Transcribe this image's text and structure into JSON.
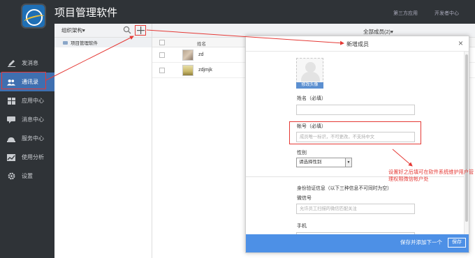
{
  "header": {
    "app_title": "项目管理软件",
    "links": [
      "第三方应用",
      "开发者中心"
    ]
  },
  "sidebar": {
    "items": [
      {
        "label": "发消息",
        "icon": "pencil-icon"
      },
      {
        "label": "通讯录",
        "icon": "contacts-icon",
        "active": true
      },
      {
        "label": "应用中心",
        "icon": "apps-grid-icon"
      },
      {
        "label": "消息中心",
        "icon": "message-icon"
      },
      {
        "label": "服务中心",
        "icon": "cloud-service-icon"
      },
      {
        "label": "使用分析",
        "icon": "chart-icon"
      },
      {
        "label": "设置",
        "icon": "gear-icon"
      }
    ],
    "active_color": "#3f6fb0"
  },
  "org": {
    "dropdown_label": "组织架构▾",
    "root_label": "项目管理软件"
  },
  "member_list": {
    "filter_label": "全部成员(2)▾",
    "column_name": "姓名",
    "rows": [
      {
        "name": "zd"
      },
      {
        "name": "zdjmjk"
      }
    ]
  },
  "modal": {
    "title": "新增成员",
    "close_label": "×",
    "avatar_button": "修改头像",
    "name_label": "姓名（必填）",
    "name_value": "",
    "account_label": "帐号（必填）",
    "account_placeholder": "成员唯一标识，不可更改，不支持中文",
    "gender_label": "性别",
    "gender_value": "请选择性别",
    "identity_note": "身份验证信息（以下三种信息不可同时为空）",
    "wechat_label": "微信号",
    "wechat_placeholder": "允许员工扫描的微信匹配关注",
    "phone_label": "手机",
    "save_next_label": "保存并添加下一个",
    "save_label": "保存",
    "accent_color": "#4d90e6"
  },
  "annotation": {
    "text": "设置好之后填可在软件系统维护用户管理权限微信帐户处",
    "color": "#e53935"
  }
}
